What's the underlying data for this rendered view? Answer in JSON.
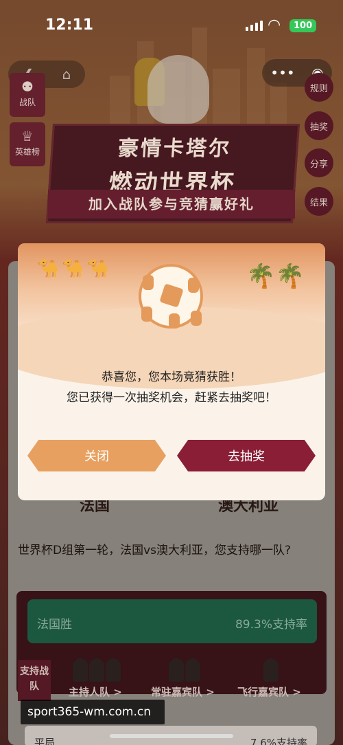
{
  "status_bar": {
    "time": "12:11",
    "battery": "100"
  },
  "nav": {
    "back_glyph": "❮",
    "home_glyph": "⌂",
    "more_glyph": "•••",
    "target_glyph": "◉"
  },
  "left_badges": [
    {
      "label": "战队",
      "icon": "team-icon"
    },
    {
      "label": "英雄榜",
      "icon": "trophy-icon"
    }
  ],
  "right_buttons": [
    "规则",
    "抽奖",
    "分享",
    "结果"
  ],
  "banner": {
    "line1": "豪情卡塔尔",
    "line2": "燃动世界杯",
    "subtitle": "加入战队参与竞猜赢好礼"
  },
  "match": {
    "team_left": "法国",
    "team_right": "澳大利亚",
    "question": "世界杯D组第一轮，法国vs澳大利亚，您支持哪一队?"
  },
  "vote": {
    "option_1_label": "法国胜",
    "option_1_rate": "89.3%支持率",
    "option_2_label": "平局",
    "option_2_rate": "7.6%支持率"
  },
  "support": {
    "label": "支持战队",
    "groups": [
      "主持人队 >",
      "常驻嘉宾队 >",
      "飞行嘉宾队 >"
    ]
  },
  "watermark": "sport365-wm.com.cn",
  "modal": {
    "line1": "恭喜您，您本场竞猜获胜！",
    "line2": "您已获得一次抽奖机会，赶紧去抽奖吧！",
    "close_label": "关闭",
    "draw_label": "去抽奖",
    "camels_glyph": "🐪🐪🐪",
    "palms_glyph": "🌴🌴"
  },
  "colors": {
    "accent": "#8a1e36",
    "secondary": "#e8a060",
    "vote_green": "#1e5c44"
  }
}
